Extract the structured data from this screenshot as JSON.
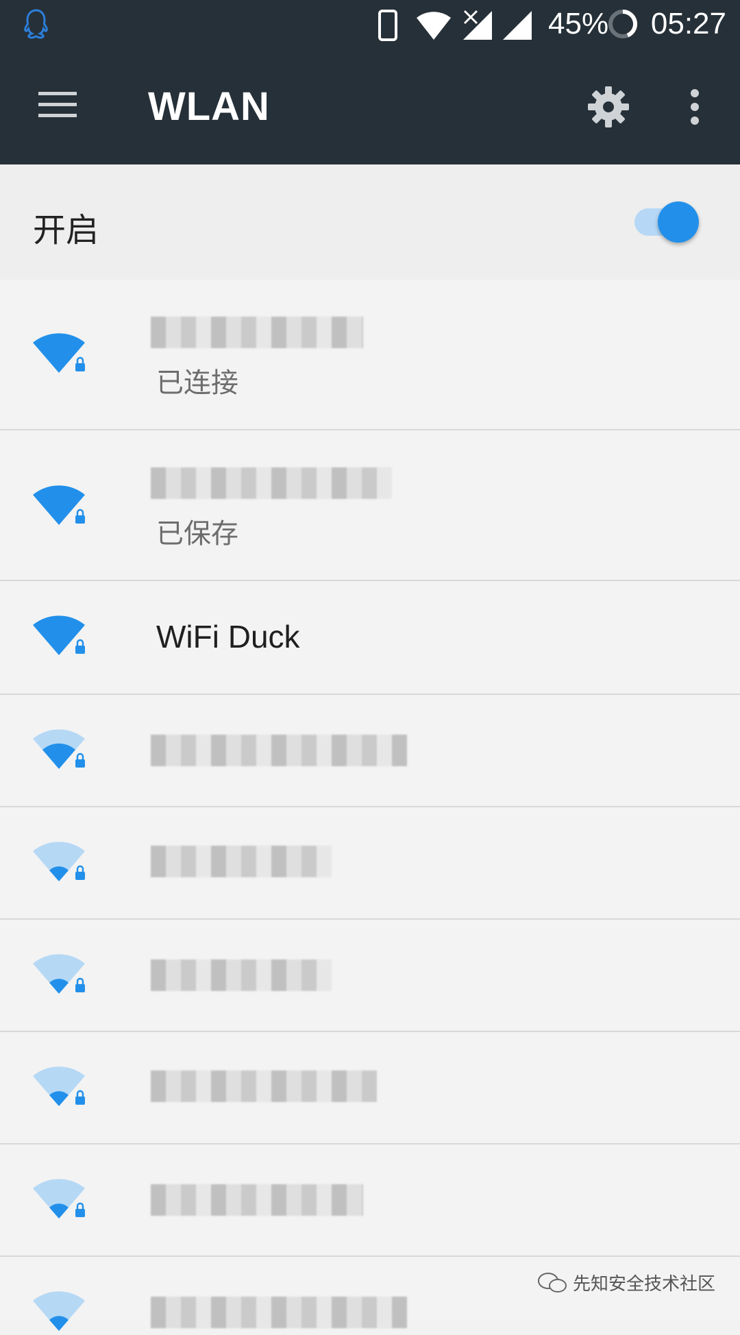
{
  "status_bar": {
    "battery": "45%",
    "time": "05:27",
    "icons": [
      "qq-icon",
      "phone-icon",
      "wifi-signal-icon",
      "no-data-x-icon",
      "cell-signal-icon",
      "cell-signal-icon",
      "battery-ring-icon"
    ]
  },
  "toolbar": {
    "title": "WLAN",
    "menu_icon": "hamburger-menu-icon",
    "settings_icon": "gear-icon",
    "overflow_icon": "more-vert-icon"
  },
  "wlan_switch": {
    "label": "开启",
    "enabled": true
  },
  "networks": [
    {
      "name": "",
      "status": "已连接",
      "signal": 4,
      "secured": true,
      "obscured": true
    },
    {
      "name": "",
      "status": "已保存",
      "signal": 4,
      "secured": true,
      "obscured": true
    },
    {
      "name": "WiFi Duck",
      "status": "",
      "signal": 4,
      "secured": true,
      "obscured": false
    },
    {
      "name": "",
      "status": "",
      "signal": 2,
      "secured": true,
      "obscured": true
    },
    {
      "name": "",
      "status": "",
      "signal": 1,
      "secured": true,
      "obscured": true
    },
    {
      "name": "",
      "status": "",
      "signal": 1,
      "secured": true,
      "obscured": true
    },
    {
      "name": "",
      "status": "",
      "signal": 1,
      "secured": true,
      "obscured": true
    },
    {
      "name": "",
      "status": "",
      "signal": 1,
      "secured": true,
      "obscured": true
    },
    {
      "name": "",
      "status": "",
      "signal": 1,
      "secured": true,
      "obscured": true
    }
  ],
  "watermark": "先知安全技术社区",
  "colors": {
    "accent": "#2290ea",
    "toolbar": "#263038"
  }
}
